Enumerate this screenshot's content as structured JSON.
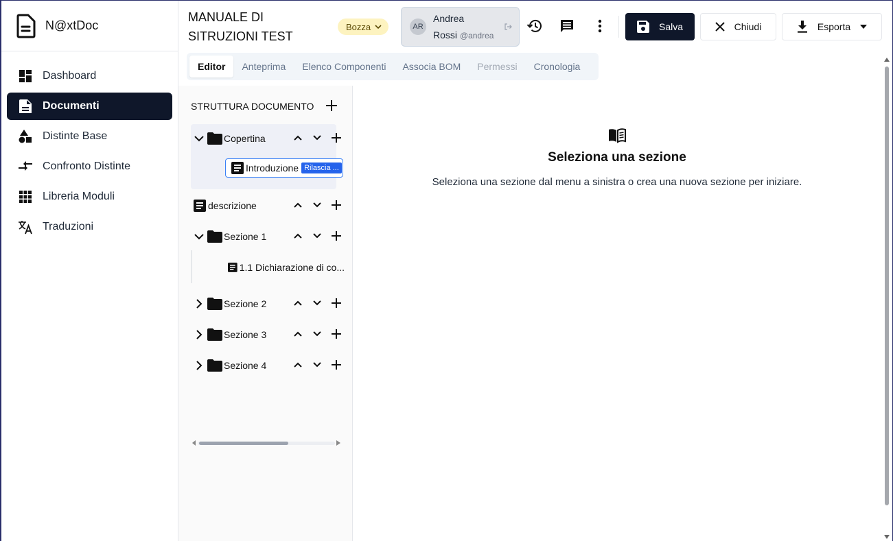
{
  "app": {
    "name": "N@xtDoc"
  },
  "sidebar": {
    "items": [
      {
        "label": "Dashboard",
        "icon": "dashboard-icon"
      },
      {
        "label": "Documenti",
        "icon": "document-icon",
        "active": true
      },
      {
        "label": "Distinte Base",
        "icon": "shapes-icon"
      },
      {
        "label": "Confronto Distinte",
        "icon": "compare-arrows-icon"
      },
      {
        "label": "Libreria Moduli",
        "icon": "grid-icon"
      },
      {
        "label": "Traduzioni",
        "icon": "translate-icon"
      }
    ]
  },
  "header": {
    "title": "MANUALE DI SITRUZIONI TEST",
    "status_badge": "Bozza",
    "user": {
      "initials": "AR",
      "first_name": "Andrea",
      "last_name": "Rossi",
      "handle": "@andrea"
    },
    "save_label": "Salva",
    "close_label": "Chiudi",
    "export_label": "Esporta"
  },
  "tabs": [
    {
      "label": "Editor",
      "state": "active"
    },
    {
      "label": "Anteprima",
      "state": "normal"
    },
    {
      "label": "Elenco Componenti",
      "state": "normal"
    },
    {
      "label": "Associa BOM",
      "state": "normal"
    },
    {
      "label": "Permessi",
      "state": "disabled"
    },
    {
      "label": "Cronologia",
      "state": "normal"
    }
  ],
  "tree": {
    "heading": "STRUTTURA DOCUMENTO",
    "nodes": [
      {
        "label": "Copertina",
        "type": "folder",
        "expanded": true
      },
      {
        "label": "Introduzione",
        "type": "document",
        "tag": "Rilascia ...",
        "selected": true
      },
      {
        "label": "descrizione",
        "type": "document"
      },
      {
        "label": "Sezione 1",
        "type": "folder",
        "expanded": true
      },
      {
        "label": "1.1 Dichiarazione di co...",
        "type": "document"
      },
      {
        "label": "Sezione 2",
        "type": "folder",
        "expanded": false
      },
      {
        "label": "Sezione 3",
        "type": "folder",
        "expanded": false
      },
      {
        "label": "Sezione 4",
        "type": "folder",
        "expanded": false
      }
    ]
  },
  "empty_state": {
    "title": "Seleziona una sezione",
    "message": "Seleziona una sezione dal menu a sinistra o crea una nuova sezione per iniziare."
  },
  "colors": {
    "primary": "#0f172a",
    "badge_bg": "#fdf3c0",
    "selection": "#3b82f6",
    "tag": "#2563eb"
  }
}
